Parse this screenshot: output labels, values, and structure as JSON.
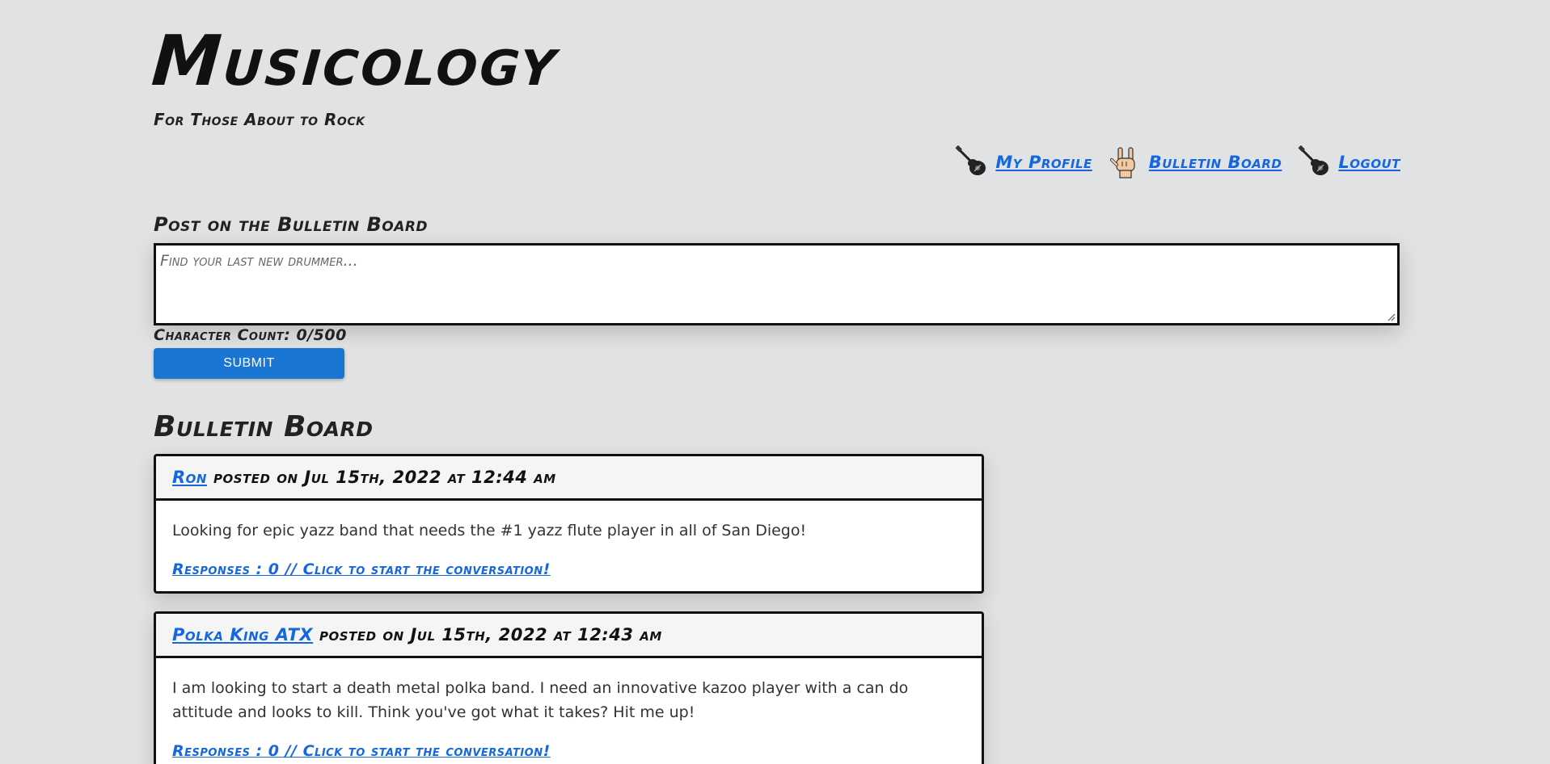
{
  "header": {
    "title": "Musicology",
    "tagline": "For Those About to Rock"
  },
  "nav": {
    "items": [
      {
        "label": "My Profile",
        "icon": "guitar-icon"
      },
      {
        "label": "Bulletin Board",
        "icon": "rock-hand-icon"
      },
      {
        "label": "Logout",
        "icon": "guitar-icon"
      }
    ]
  },
  "post_form": {
    "label": "Post on the Bulletin Board",
    "placeholder": "Find your last new drummer...",
    "value": "",
    "char_count": "Character Count: 0/500",
    "submit_label": "SUBMIT"
  },
  "board": {
    "title": "Bulletin Board",
    "posts": [
      {
        "author": "Ron",
        "meta": "posted on Jul 15th, 2022 at 12:44 am",
        "body": "Looking for epic yazz band that needs the #1 yazz flute player in all of San Diego!",
        "responses": "Responses : 0 // Click to start the conversation!"
      },
      {
        "author": "Polka King ATX",
        "meta": "posted on Jul 15th, 2022 at 12:43 am",
        "body": "I am looking to start a death metal polka band. I need an innovative kazoo player with a can do attitude and looks to kill. Think you've got what it takes? Hit me up!",
        "responses": "Responses : 0 // Click to start the conversation!"
      }
    ]
  },
  "colors": {
    "background": "#e0e2e4",
    "link": "#1567e0",
    "button": "#1976d2"
  }
}
